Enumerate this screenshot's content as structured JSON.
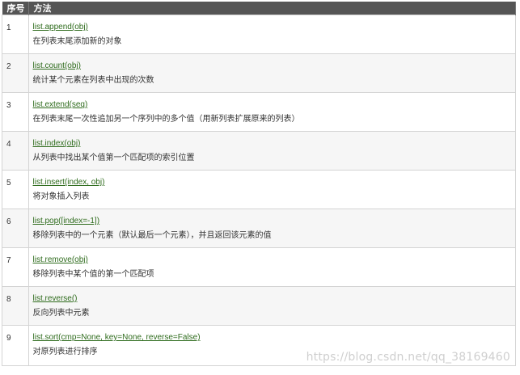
{
  "table": {
    "headers": {
      "num": "序号",
      "method": "方法"
    },
    "rows": [
      {
        "num": "1",
        "method": "list.append(obj)",
        "desc": "在列表末尾添加新的对象"
      },
      {
        "num": "2",
        "method": "list.count(obj)",
        "desc": "统计某个元素在列表中出现的次数"
      },
      {
        "num": "3",
        "method": "list.extend(seq)",
        "desc": "在列表末尾一次性追加另一个序列中的多个值（用新列表扩展原来的列表）"
      },
      {
        "num": "4",
        "method": "list.index(obj)",
        "desc": "从列表中找出某个值第一个匹配项的索引位置"
      },
      {
        "num": "5",
        "method": "list.insert(index, obj)",
        "desc": "将对象插入列表"
      },
      {
        "num": "6",
        "method": "list.pop([index=-1])",
        "desc": "移除列表中的一个元素（默认最后一个元素），并且返回该元素的值"
      },
      {
        "num": "7",
        "method": "list.remove(obj)",
        "desc": "移除列表中某个值的第一个匹配项"
      },
      {
        "num": "8",
        "method": "list.reverse()",
        "desc": "反向列表中元素"
      },
      {
        "num": "9",
        "method": "list.sort(cmp=None, key=None, reverse=False)",
        "desc": "对原列表进行排序"
      }
    ]
  },
  "watermark": "https://blog.csdn.net/qq_38169460",
  "colors": {
    "header_bg": "#555555",
    "link": "#2e6b1c",
    "row_alt": "#f6f6f6"
  }
}
